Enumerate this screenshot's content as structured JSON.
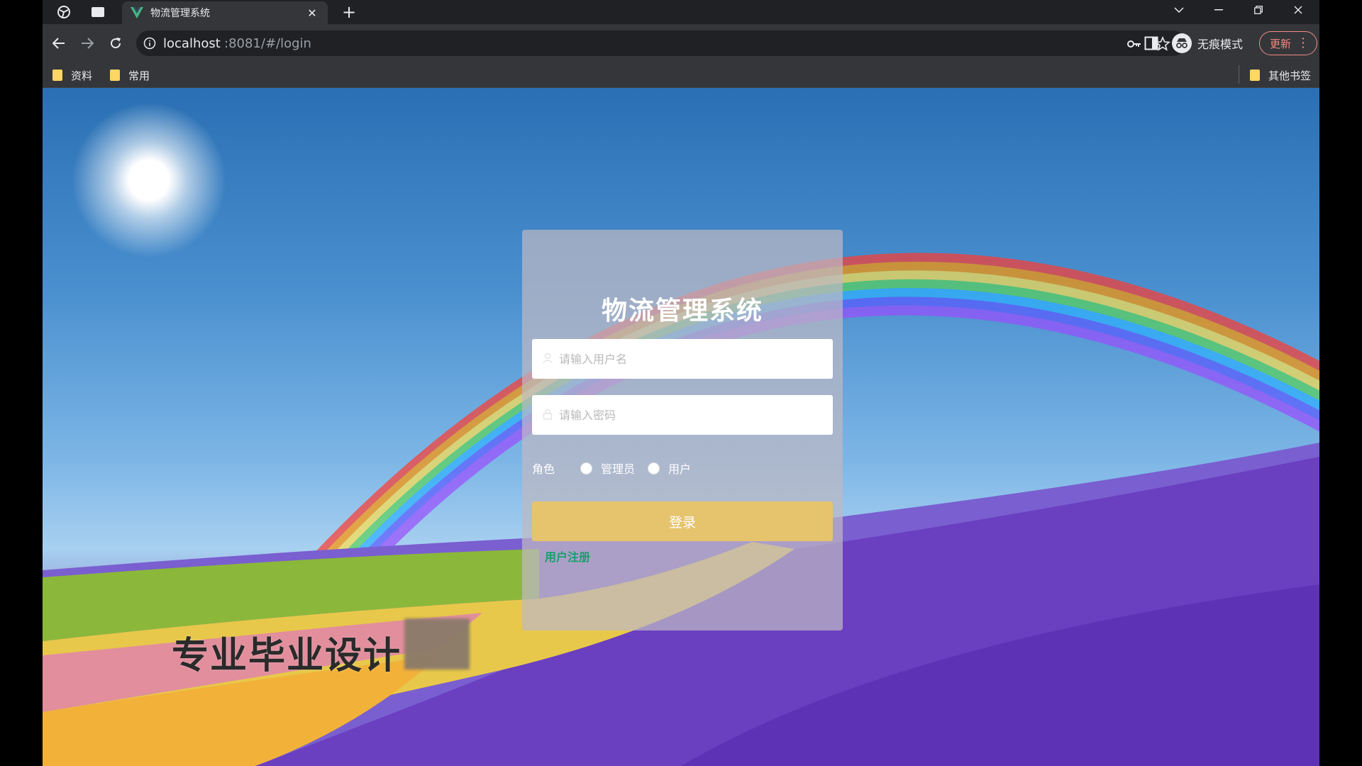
{
  "browser": {
    "tab": {
      "title": "物流管理系统",
      "close": "✕"
    },
    "new_tab": "+",
    "address": {
      "host": "localhost",
      "rest": ":8081/#/login"
    },
    "incognito_label": "无痕模式",
    "update_label": "更新",
    "bookmarks": [
      {
        "label": "资料"
      },
      {
        "label": "常用"
      }
    ],
    "other_bookmarks": "其他书签"
  },
  "login": {
    "title": "物流管理系统",
    "username_placeholder": "请输入用户名",
    "password_placeholder": "请输入密码",
    "role_label": "角色",
    "roles": [
      "管理员",
      "用户"
    ],
    "login_button": "登录",
    "register_link": "用户注册"
  },
  "watermark": "专业毕业设计"
}
